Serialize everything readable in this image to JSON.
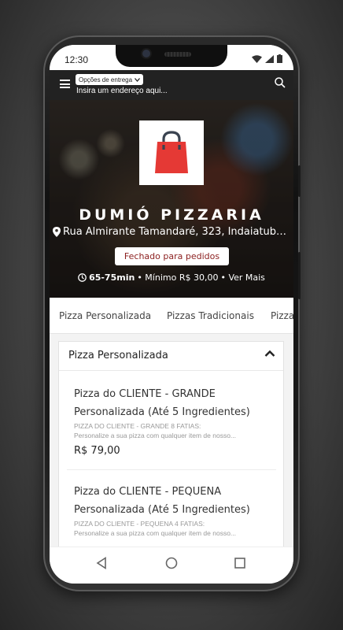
{
  "status_bar": {
    "time": "12:30"
  },
  "app_bar": {
    "delivery_option": "Opções de entrega",
    "address_placeholder": "Insira um endereço aqui..."
  },
  "store": {
    "name": "DUMIÓ PIZZARIA",
    "address": "Rua Almirante Tamandaré, 323, Indaiatub…",
    "status": "Fechado para pedidos",
    "delivery_time": "65-75min",
    "minimum": "• Mínimo R$ 30,00",
    "more": "• Ver Mais",
    "logo_icon": "shopping-bag-icon",
    "bag_color": "#e53935"
  },
  "category_tabs": [
    "Pizza Personalizada",
    "Pizzas Tradicionais",
    "Pizza"
  ],
  "section": {
    "title": "Pizza Personalizada",
    "products": [
      {
        "name_line1": "Pizza do CLIENTE - GRANDE",
        "name_line2": "Personalizada (Até 5 Ingredientes)",
        "desc_line1": "PIZZA DO CLIENTE - GRANDE 8 FATIAS:",
        "desc_line2": "Personalize a sua pizza com qualquer item de nosso...",
        "price": "R$ 79,00"
      },
      {
        "name_line1": "Pizza do CLIENTE - PEQUENA",
        "name_line2": "Personalizada (Até 5 Ingredientes)",
        "desc_line1": "PIZZA DO CLIENTE - PEQUENA 4 FATIAS:",
        "desc_line2": "Personalize a sua pizza com qualquer item de nosso..."
      }
    ]
  }
}
